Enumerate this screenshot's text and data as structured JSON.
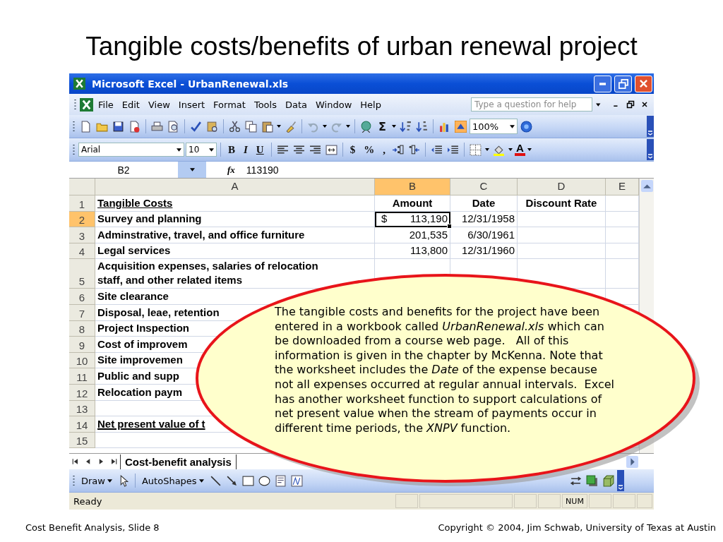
{
  "slide": {
    "title": "Tangible costs/benefits of urban renewal project",
    "footer_left": "Cost Benefit Analysis, Slide 8",
    "footer_right": "Copyright © 2004, Jim Schwab, University of Texas at Austin"
  },
  "window": {
    "title": "Microsoft Excel - UrbanRenewal.xls"
  },
  "menu": {
    "items": [
      "File",
      "Edit",
      "View",
      "Insert",
      "Format",
      "Tools",
      "Data",
      "Window",
      "Help"
    ],
    "help_placeholder": "Type a question for help"
  },
  "standard_toolbar": {
    "sum": "Σ",
    "zoom": "100%"
  },
  "formatting_toolbar": {
    "font": "Arial",
    "size": "10",
    "style_buttons": [
      "B",
      "I",
      "U"
    ],
    "number_buttons": [
      "$",
      "%",
      ","
    ],
    "font_color": "A"
  },
  "formula_bar": {
    "name_box": "B2",
    "function_symbol": "fx",
    "value": "113190"
  },
  "columns": [
    {
      "label": "A",
      "selected": false
    },
    {
      "label": "B",
      "selected": true
    },
    {
      "label": "C",
      "selected": false
    },
    {
      "label": "D",
      "selected": false
    },
    {
      "label": "E",
      "selected": false
    }
  ],
  "rows": [
    {
      "number": "1",
      "kind": "heading",
      "selected": false,
      "a": "Tangible Costs",
      "b": "Amount",
      "c": "Date",
      "d": "Discount Rate"
    },
    {
      "number": "2",
      "kind": "item",
      "selected": true,
      "a": "Survey and planning",
      "b_currency": "$",
      "b": "113,190",
      "c": "12/31/1958"
    },
    {
      "number": "3",
      "kind": "item",
      "selected": false,
      "a": "Adminstrative, travel, and office furniture",
      "b": "201,535",
      "c": "6/30/1961"
    },
    {
      "number": "4",
      "kind": "item",
      "selected": false,
      "a": "Legal services",
      "b": "113,800",
      "c": "12/31/1960"
    },
    {
      "number": "5",
      "kind": "item",
      "selected": false,
      "a": "Acquisition expenses, salaries of relocation staff, and other related items"
    },
    {
      "number": "6",
      "kind": "item",
      "selected": false,
      "a": "Site clearance"
    },
    {
      "number": "7",
      "kind": "item",
      "selected": false,
      "a": "Disposal, leae, retention"
    },
    {
      "number": "8",
      "kind": "item",
      "selected": false,
      "a": "Project Inspection"
    },
    {
      "number": "9",
      "kind": "item",
      "selected": false,
      "a": "Cost of improvem"
    },
    {
      "number": "10",
      "kind": "item",
      "selected": false,
      "a": "Site improvemen"
    },
    {
      "number": "11",
      "kind": "item",
      "selected": false,
      "a": "Public and supp"
    },
    {
      "number": "12",
      "kind": "item",
      "selected": false,
      "a": "Relocation paym"
    },
    {
      "number": "13",
      "selected": false
    },
    {
      "number": "14",
      "kind": "total",
      "selected": false,
      "a": "Net present value of t"
    },
    {
      "number": "15",
      "selected": false
    }
  ],
  "sheet_tabs": [
    {
      "label": "Cost-benefit analysis",
      "selected": true
    }
  ],
  "drawing_toolbar": {
    "draw": "Draw",
    "autoshapes": "AutoShapes"
  },
  "status_bar": {
    "state": "Ready",
    "indicator": "NUM"
  },
  "callout": {
    "text": "The tangible costs and benefits for the project have been entered in a workbook called *UrbanRenewal.xls* which can be downloaded from a course web page.   All of this information is given in the chapter by McKenna. Note that the worksheet includes the *Date* of the expense because not all expenses occurred at regular annual intervals.  Excel has another worksheet function to support calculations of net present value when the stream of payments occur in different time periods, the *XNPV* function."
  }
}
